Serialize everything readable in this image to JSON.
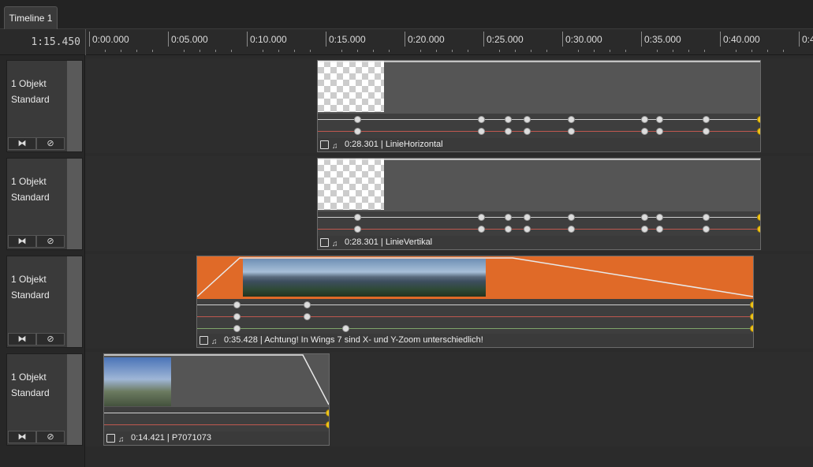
{
  "tab": {
    "label": "Timeline 1"
  },
  "timecode": "1:15.450",
  "ruler": {
    "labels": [
      "0:00.000",
      "0:05.000",
      "0:10.000",
      "0:15.000",
      "0:20.000",
      "0:25.000",
      "0:30.000",
      "0:35.000",
      "0:40.000",
      "0:4"
    ]
  },
  "tracks": [
    {
      "objects": "1 Objekt",
      "mode": "Standard",
      "btn_link": "⧓",
      "btn_mute": "⊘",
      "clip_time": "0:28.301",
      "clip_name": "LinieHorizontal"
    },
    {
      "objects": "1 Objekt",
      "mode": "Standard",
      "btn_link": "⧓",
      "btn_mute": "⊘",
      "clip_time": "0:28.301",
      "clip_name": "LinieVertikal"
    },
    {
      "objects": "1 Objekt",
      "mode": "Standard",
      "btn_link": "⧓",
      "btn_mute": "⊘",
      "clip_time": "0:35.428",
      "clip_name": "Achtung! In Wings 7 sind X- und Y-Zoom unterschiedlich!"
    },
    {
      "objects": "1 Objekt",
      "mode": "Standard",
      "btn_link": "⧓",
      "btn_mute": "⊘",
      "clip_time": "0:14.421",
      "clip_name": "P7071073"
    }
  ],
  "icons": {
    "image": "image-icon",
    "audio": "audio-icon"
  },
  "colors": {
    "accent_orange": "#e06a28",
    "keyframe_yellow": "#f0c419",
    "line_white": "#cfcfcf",
    "line_red": "#c0584f",
    "line_green": "#7fa56b"
  }
}
